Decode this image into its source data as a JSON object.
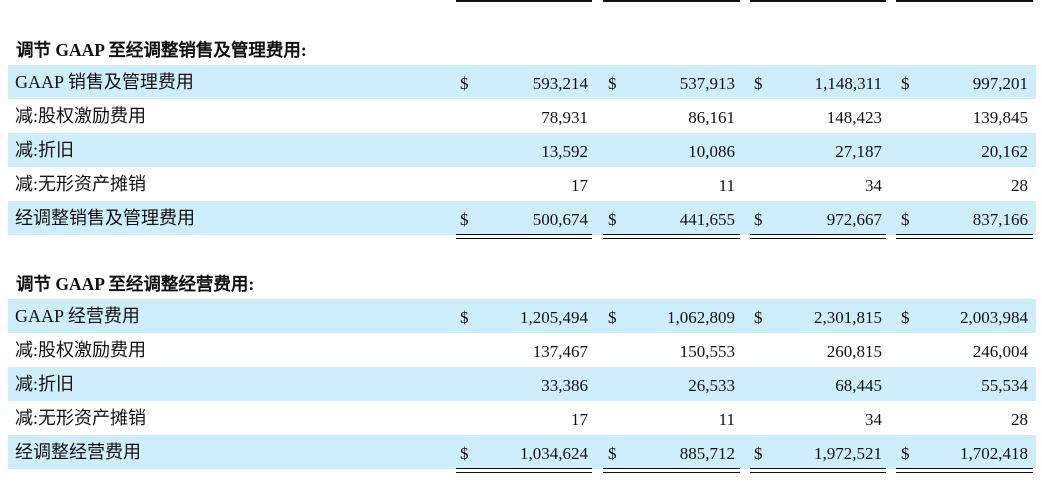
{
  "currency_symbol": "$",
  "sections": [
    {
      "title": "调节 GAAP 至经调整销售及管理费用:",
      "rows": [
        {
          "label": "GAAP 销售及管理费用",
          "values": [
            "593,214",
            "537,913",
            "1,148,311",
            "997,201"
          ],
          "show_currency": true
        },
        {
          "label": "减:股权激励费用",
          "values": [
            "78,931",
            "86,161",
            "148,423",
            "139,845"
          ],
          "show_currency": false
        },
        {
          "label": "减:折旧",
          "values": [
            "13,592",
            "10,086",
            "27,187",
            "20,162"
          ],
          "show_currency": false
        },
        {
          "label": "减:无形资产摊销",
          "values": [
            "17",
            "11",
            "34",
            "28"
          ],
          "show_currency": false
        },
        {
          "label": "经调整销售及管理费用",
          "values": [
            "500,674",
            "441,655",
            "972,667",
            "837,166"
          ],
          "show_currency": true
        }
      ]
    },
    {
      "title": "调节 GAAP 至经调整经营费用:",
      "rows": [
        {
          "label": "GAAP 经营费用",
          "values": [
            "1,205,494",
            "1,062,809",
            "2,301,815",
            "2,003,984"
          ],
          "show_currency": true
        },
        {
          "label": "减:股权激励费用",
          "values": [
            "137,467",
            "150,553",
            "260,815",
            "246,004"
          ],
          "show_currency": false
        },
        {
          "label": "减:折旧",
          "values": [
            "33,386",
            "26,533",
            "68,445",
            "55,534"
          ],
          "show_currency": false
        },
        {
          "label": "减:无形资产摊销",
          "values": [
            "17",
            "11",
            "34",
            "28"
          ],
          "show_currency": false
        },
        {
          "label": "经调整经营费用",
          "values": [
            "1,034,624",
            "885,712",
            "1,972,521",
            "1,702,418"
          ],
          "show_currency": true
        }
      ]
    }
  ]
}
